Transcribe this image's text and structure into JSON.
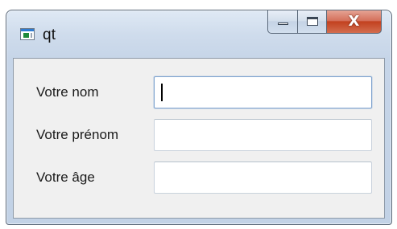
{
  "window": {
    "title": "qt",
    "app_icon": "qt-app-icon",
    "controls": {
      "minimize": "minimize-icon",
      "maximize": "maximize-icon",
      "close_glyph": "X"
    }
  },
  "form": {
    "fields": [
      {
        "label": "Votre nom",
        "value": "",
        "focused": true
      },
      {
        "label": "Votre prénom",
        "value": "",
        "focused": false
      },
      {
        "label": "Votre âge",
        "value": "",
        "focused": false
      }
    ]
  },
  "colors": {
    "close_button": "#c7503a",
    "focus_border": "#7da2ce",
    "client_background": "#f0f0f0"
  }
}
